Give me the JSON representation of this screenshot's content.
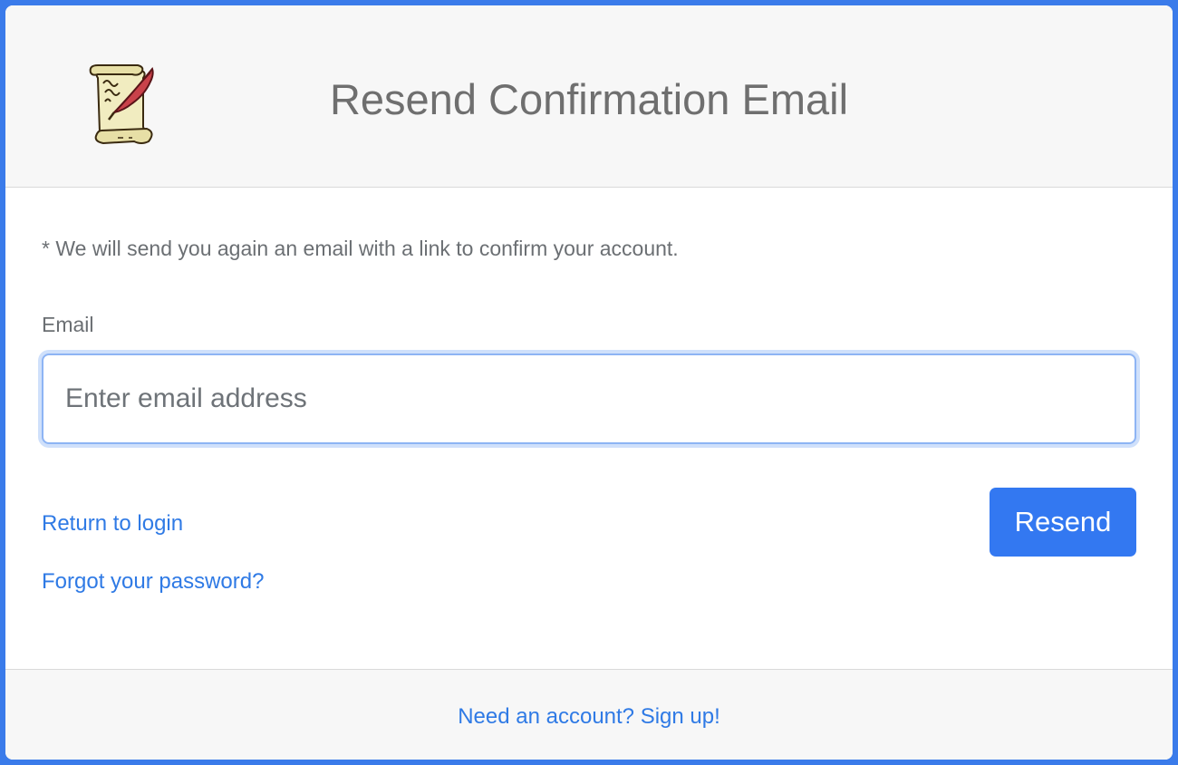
{
  "header": {
    "title": "Resend Confirmation Email",
    "logo_icon": "scroll-quill-icon"
  },
  "form": {
    "notice": "* We will send you again an email with a link to confirm your account.",
    "email_label": "Email",
    "email_placeholder": "Enter email address",
    "email_value": "",
    "submit_label": "Resend"
  },
  "links": {
    "return_to_login": "Return to login",
    "forgot_password": "Forgot your password?"
  },
  "footer": {
    "signup_link": "Need an account? Sign up!"
  },
  "colors": {
    "page_background": "#3a7bea",
    "primary_button": "#3378f1",
    "link": "#2f7ae5",
    "header_background": "#f7f7f7"
  }
}
